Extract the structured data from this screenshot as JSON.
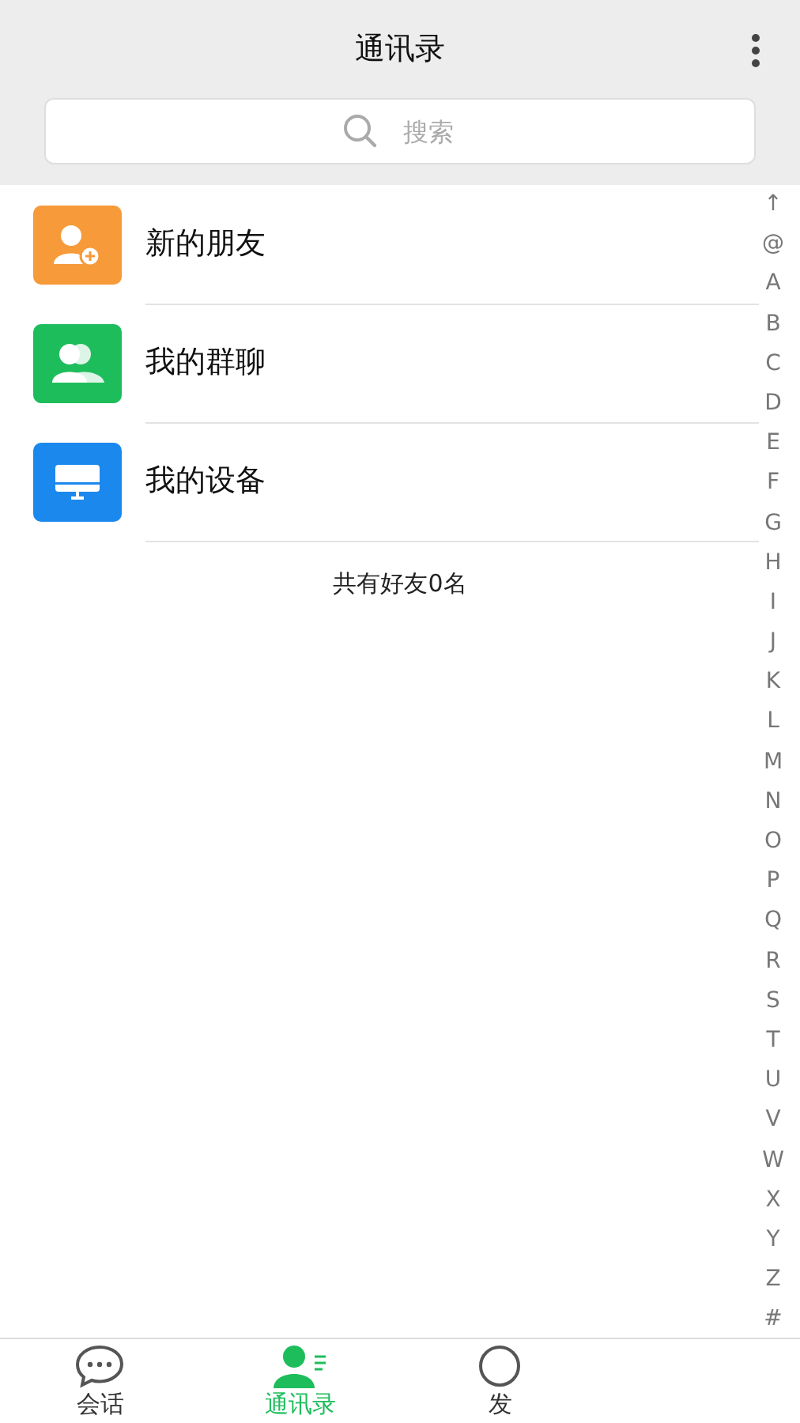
{
  "header": {
    "title": "通讯录"
  },
  "search": {
    "placeholder": "搜索"
  },
  "entries": [
    {
      "kind": "new-friend",
      "label": "新的朋友"
    },
    {
      "kind": "group",
      "label": "我的群聊"
    },
    {
      "kind": "device",
      "label": "我的设备"
    }
  ],
  "friend_count": "共有好友0名",
  "index_bar": [
    "↑",
    "@",
    "A",
    "B",
    "C",
    "D",
    "E",
    "F",
    "G",
    "H",
    "I",
    "J",
    "K",
    "L",
    "M",
    "N",
    "O",
    "P",
    "Q",
    "R",
    "S",
    "T",
    "U",
    "V",
    "W",
    "X",
    "Y",
    "Z",
    "#"
  ],
  "tabs": [
    {
      "kind": "chat",
      "label": "会话",
      "selected": false
    },
    {
      "kind": "contacts",
      "label": "通讯录",
      "selected": true
    },
    {
      "kind": "discover",
      "label": "发",
      "selected": false
    }
  ]
}
